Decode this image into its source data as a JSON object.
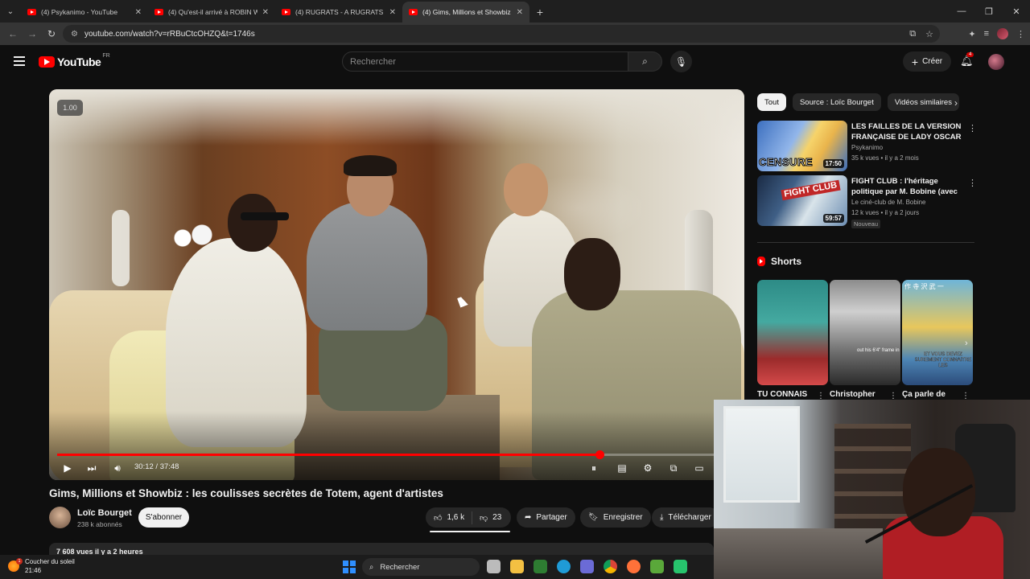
{
  "browser": {
    "tabs": [
      {
        "title": "(4) Psykanimo - YouTube",
        "active": false
      },
      {
        "title": "(4) Qu'est-il arrivé à ROBIN WI",
        "active": false
      },
      {
        "title": "(4) RUGRATS - A RUGRATS VAC",
        "active": false
      },
      {
        "title": "(4) Gims, Millions et Showbiz : l",
        "active": true
      }
    ],
    "url": "youtube.com/watch?v=rRBuCtcOHZQ&t=1746s"
  },
  "masthead": {
    "logo_text": "YouTube",
    "country": "FR",
    "search_placeholder": "Rechercher",
    "create_label": "Créer",
    "notifications_count": "4"
  },
  "player": {
    "speed": "1.00",
    "current_time": "30:12",
    "duration": "37:48",
    "time_display": "30:12 / 37:48",
    "progress_fraction": 0.799
  },
  "video": {
    "title": "Gims, Millions et Showbiz : les coulisses secrètes de Totem, agent d'artistes",
    "channel": "Loïc Bourget",
    "subscribers": "238 k abonnés",
    "subscribe_label": "S'abonner",
    "likes": "1,6 k",
    "dislikes": "23",
    "share_label": "Partager",
    "save_label": "Enregistrer",
    "download_label": "Télécharger",
    "views_line": "7 608 vues  il y a 2 heures"
  },
  "sidebar": {
    "chips": [
      "Tout",
      "Source : Loïc Bourget",
      "Vidéos similaires"
    ],
    "recommendations": [
      {
        "title": "LES FAILLES DE LA VERSION FRANÇAISE DE LADY OSCAR :...",
        "channel": "Psykanimo",
        "meta": "35 k vues • il y a 2 mois",
        "duration": "17:50",
        "thumb_text": "CENSURE",
        "badge": ""
      },
      {
        "title": "FIGHT CLUB : l'héritage politique par M. Bobine (avec ...",
        "channel": "Le ciné-club de M. Bobine",
        "meta": "12 k vues • il y a 2 jours",
        "duration": "59:57",
        "thumb_text": "FIGHT CLUB",
        "badge": "Nouveau"
      }
    ],
    "shorts_heading": "Shorts",
    "shorts": [
      {
        "title": "TU CONNAIS",
        "caption": ""
      },
      {
        "title": "Christopher",
        "caption": "out his 6'4\" frame in"
      },
      {
        "title": "Ça parle de",
        "caption": "ET VOUS DEVEZ SUREMENT CONNAITRE LES"
      }
    ],
    "short3_kanji": "作 寺 沢 武 一"
  },
  "taskbar": {
    "weather_title": "Coucher du soleil",
    "weather_time": "21:46",
    "weather_badge": "1",
    "search_label": "Rechercher"
  },
  "colors": {
    "youtube_red": "#ff0000",
    "background": "#0f0f0f",
    "chip_bg": "#272727"
  }
}
